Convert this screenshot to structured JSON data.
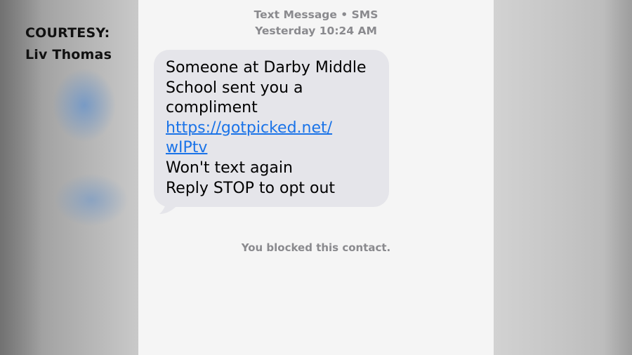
{
  "watermark": {
    "line1": "COURTESY:",
    "line2": "Liv Thomas"
  },
  "header": {
    "channel": "Text Message • SMS",
    "timestamp": "Yesterday 10:24 AM"
  },
  "message": {
    "line1": "Someone at Darby Middle",
    "line2": "School sent you a",
    "line3": "compliment",
    "link_line1": "https://gotpicked.net/",
    "link_line2": "wIPtv",
    "line4": "Won't text again",
    "line5": "Reply STOP to opt out"
  },
  "status": {
    "blocked_text": "You blocked this contact."
  },
  "colors": {
    "bubble": "#e5e5ea",
    "link": "#1a73e8",
    "meta_text": "#8a8a8e",
    "screen_bg": "#f5f5f5"
  }
}
